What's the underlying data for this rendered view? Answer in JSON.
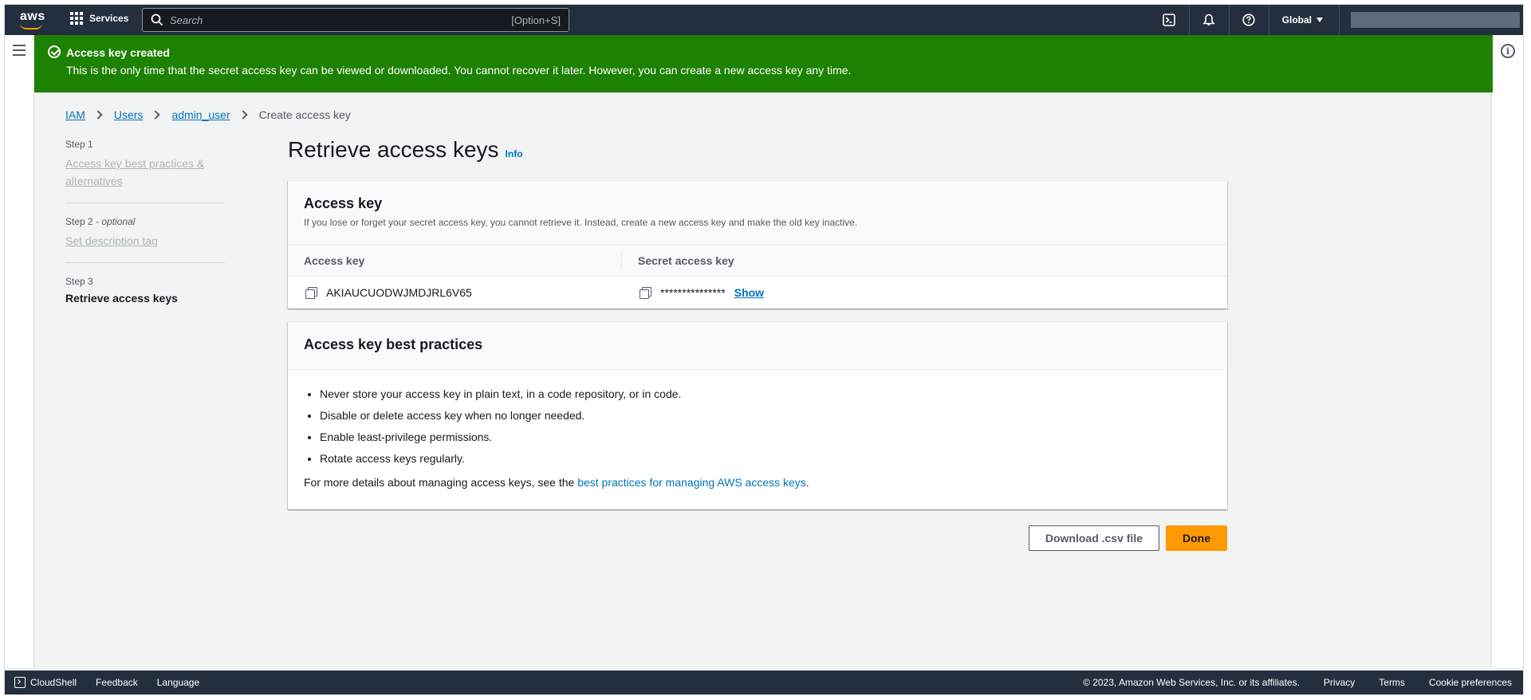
{
  "nav": {
    "logo": "aws",
    "services_label": "Services",
    "search_placeholder": "Search",
    "search_shortcut": "[Option+S]",
    "region": "Global"
  },
  "flash": {
    "title": "Access key created",
    "message": "This is the only time that the secret access key can be viewed or downloaded. You cannot recover it later. However, you can create a new access key any time."
  },
  "breadcrumb": {
    "items": [
      "IAM",
      "Users",
      "admin_user"
    ],
    "current": "Create access key"
  },
  "steps": [
    {
      "step": "Step 1",
      "optional": "",
      "label": "Access key best practices & alternatives"
    },
    {
      "step": "Step 2",
      "optional": "optional",
      "label": "Set description tag"
    },
    {
      "step": "Step 3",
      "optional": "",
      "label": "Retrieve access keys"
    }
  ],
  "main": {
    "title": "Retrieve access keys",
    "info": "Info",
    "access_key_panel": {
      "title": "Access key",
      "description": "If you lose or forget your secret access key, you cannot retrieve it. Instead, create a new access key and make the old key inactive.",
      "col_access_key": "Access key",
      "col_secret_key": "Secret access key",
      "access_key_value": "AKIAUCUODWJMDJRL6V65",
      "secret_key_masked": "***************",
      "show_label": "Show"
    },
    "best_practices_panel": {
      "title": "Access key best practices",
      "items": [
        "Never store your access key in plain text, in a code repository, or in code.",
        "Disable or delete access key when no longer needed.",
        "Enable least-privilege permissions.",
        "Rotate access keys regularly."
      ],
      "more_prefix": "For more details about managing access keys, see the ",
      "more_link": "best practices for managing AWS access keys",
      "more_suffix": "."
    },
    "download_button": "Download .csv file",
    "done_button": "Done"
  },
  "footer": {
    "cloudshell": "CloudShell",
    "feedback": "Feedback",
    "language": "Language",
    "copyright": "© 2023, Amazon Web Services, Inc. or its affiliates.",
    "privacy": "Privacy",
    "terms": "Terms",
    "cookies": "Cookie preferences"
  },
  "colors": {
    "nav_bg": "#232f3e",
    "flash_bg": "#1d8102",
    "link": "#0073bb",
    "primary_button": "#ff9900"
  }
}
